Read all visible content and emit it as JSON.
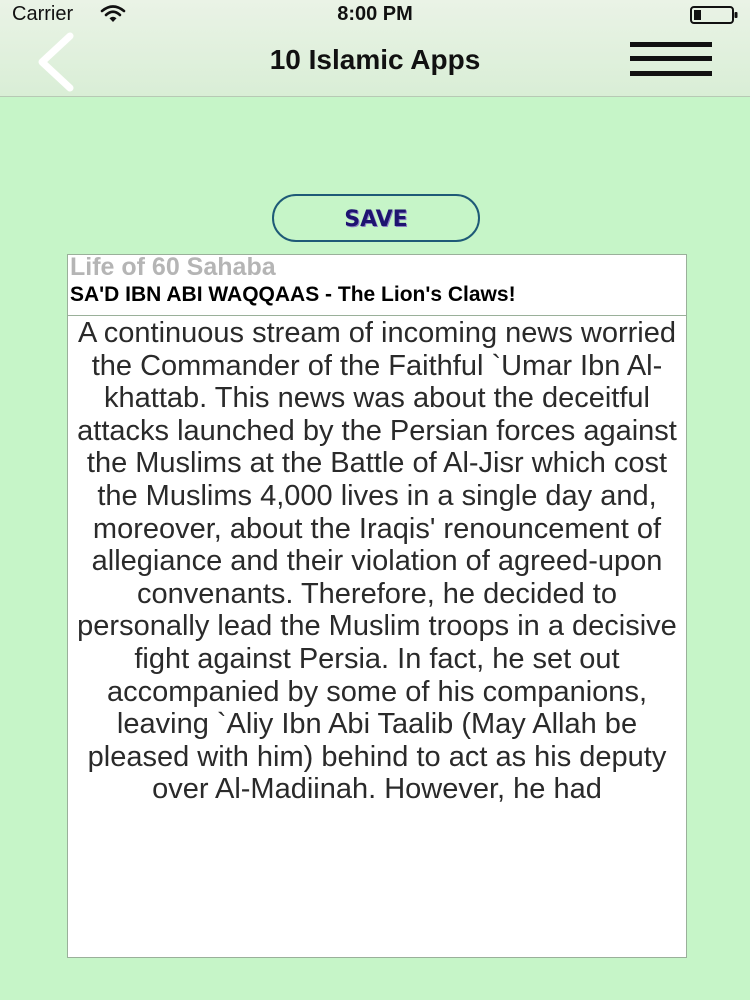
{
  "status_bar": {
    "carrier": "Carrier",
    "time": "8:00 PM"
  },
  "nav": {
    "title": "10 Islamic Apps"
  },
  "save_label": "SAVE",
  "book": {
    "title": "Life of 60 Sahaba",
    "chapter": "SA'D IBN ABI WAQQAAS - The Lion's Claws!",
    "body": "A continuous stream of incoming news worried the Commander of the Faithful `Umar Ibn Al- khattab. This news was about the deceitful attacks launched by the Persian forces against the Muslims at the Battle of Al-Jisr which cost the Muslims 4,000 lives in a single day and, moreover, about the Iraqis' renouncement of allegiance and their violation of agreed-upon convenants. Therefore, he decided to personally lead the Muslim troops in a decisive fight against Persia. In fact, he set out accompanied by some of his companions, leaving `Aliy Ibn Abi Taalib (May Allah be pleased with him) behind to act as his deputy over Al-Madiinah. However, he had"
  },
  "colors": {
    "background": "#c6f5c8",
    "panel": "#ffffff",
    "button_border": "#1e5a77",
    "button_text": "#1e1370"
  }
}
